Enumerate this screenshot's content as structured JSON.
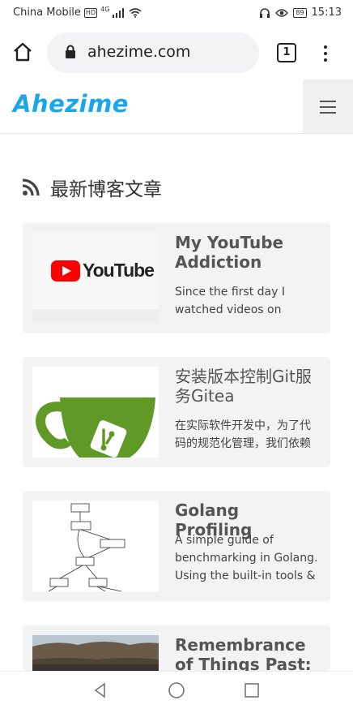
{
  "status_bar": {
    "carrier": "China Mobile",
    "hd_badge": "HD",
    "network": "4G",
    "battery": "89",
    "time": "15:13"
  },
  "browser": {
    "url": "ahezime.com",
    "tab_count": "1"
  },
  "site": {
    "logo": "Ahezime"
  },
  "section": {
    "title": "最新博客文章"
  },
  "posts": [
    {
      "title": "My YouTube Addiction",
      "excerpt": "Since the first day I watched videos on",
      "thumb_text": "YouTube"
    },
    {
      "title": "安装版本控制Git服务Gitea",
      "excerpt": "在实际软件开发中，为了代码的规范化管理，我们依赖"
    },
    {
      "title": "Golang Profiling",
      "excerpt": "A simple guide of benchmarking in Golang. Using the built-in tools &"
    },
    {
      "title": "Remembrance of Things Past: The",
      "excerpt": ""
    }
  ],
  "colors": {
    "logo": "#1aa6e8",
    "youtube_red": "#ff0000",
    "gitea_green": "#609926"
  }
}
